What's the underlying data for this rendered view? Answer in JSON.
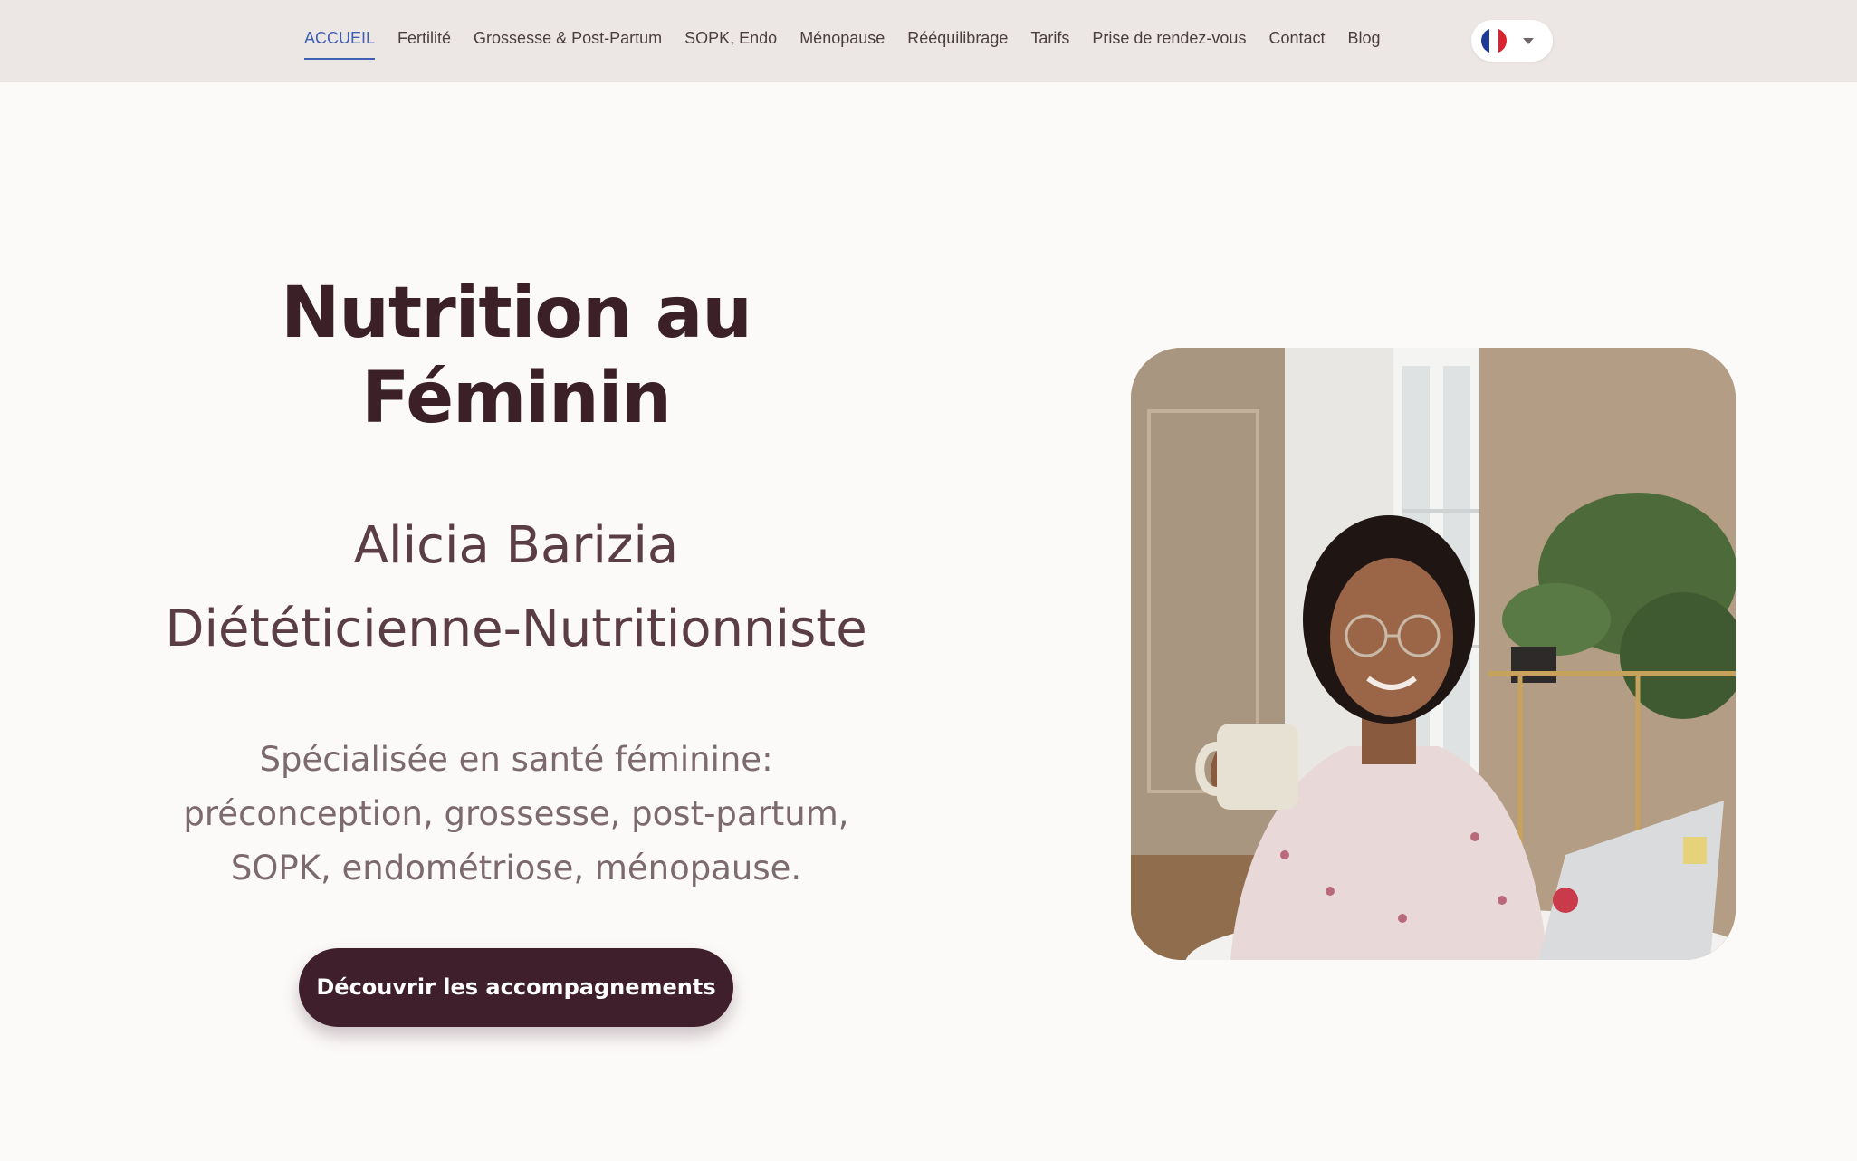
{
  "nav": {
    "items": [
      {
        "label": "ACCUEIL",
        "active": true
      },
      {
        "label": "Fertilité"
      },
      {
        "label": "Grossesse & Post-Partum"
      },
      {
        "label": "SOPK, Endo"
      },
      {
        "label": "Ménopause"
      },
      {
        "label": "Rééquilibrage"
      },
      {
        "label": "Tarifs"
      },
      {
        "label": "Prise de rendez-vous"
      },
      {
        "label": "Contact"
      },
      {
        "label": "Blog"
      }
    ]
  },
  "language": {
    "icon": "france-flag-icon",
    "caret_icon": "chevron-down-icon"
  },
  "hero": {
    "title": "Nutrition au Féminin",
    "name": "Alicia Barizia",
    "role": "Diététicienne-Nutritionniste",
    "description": "Spécialisée en santé féminine: préconception, grossesse, post-partum, SOPK, endométriose, ménopause.",
    "cta_label": "Découvrir les accompagnements"
  },
  "colors": {
    "header_bg": "#ece7e5",
    "page_bg": "#fcfaf9",
    "active_link": "#3f5fb5",
    "title": "#3b2127",
    "cta_bg": "#3e1f2b"
  }
}
